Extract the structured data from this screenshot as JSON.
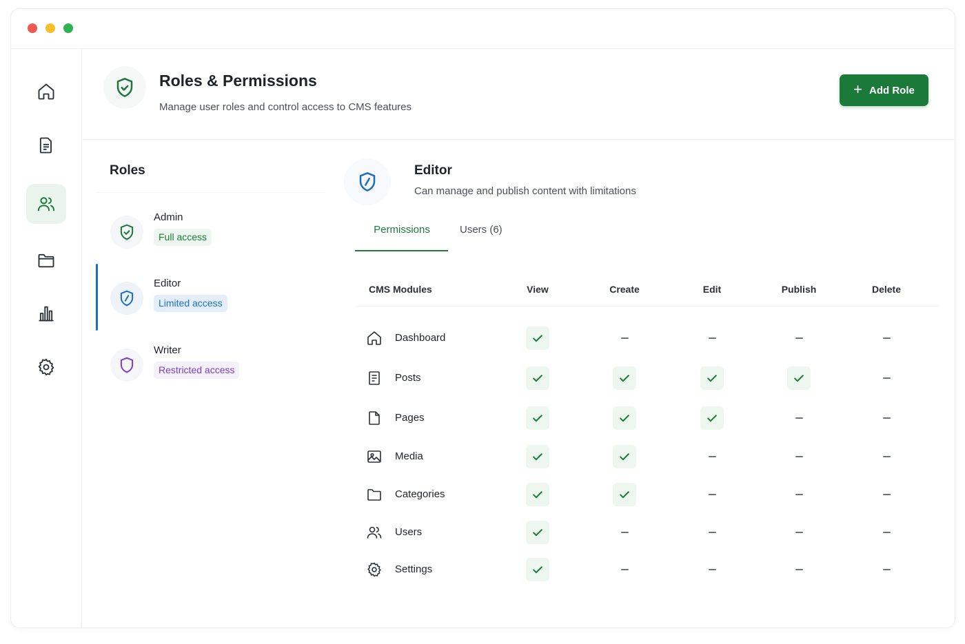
{
  "header": {
    "title": "Roles & Permissions",
    "subtitle": "Manage user roles and control access to CMS features",
    "add_role_label": "Add Role"
  },
  "nav": [
    {
      "name": "home-icon",
      "active": false
    },
    {
      "name": "document-icon",
      "active": false
    },
    {
      "name": "users-icon",
      "active": true
    },
    {
      "name": "folder-icon",
      "active": false
    },
    {
      "name": "bar-chart-icon",
      "active": false
    },
    {
      "name": "gear-icon",
      "active": false
    }
  ],
  "roles": {
    "heading": "Roles",
    "items": [
      {
        "name": "Admin",
        "badge": "Full access",
        "color": "#1b7a3a"
      },
      {
        "name": "Editor",
        "badge": "Limited access",
        "color": "#1a6fc4",
        "selected": true
      },
      {
        "name": "Writer",
        "badge": "Restricted access",
        "color": "#7a3fc6"
      }
    ]
  },
  "detail": {
    "title": "Editor",
    "subtitle": "Can manage and publish content with limitations",
    "tabs": [
      {
        "label": "Permissions",
        "active": true
      },
      {
        "label": "Users (6)",
        "active": false
      }
    ]
  },
  "permissions": {
    "columns": [
      "CMS Modules",
      "View",
      "Create",
      "Edit",
      "Publish",
      "Delete"
    ],
    "rows": [
      {
        "module": "Dashboard",
        "icon": "home-icon",
        "values": [
          true,
          false,
          false,
          false,
          false
        ]
      },
      {
        "module": "Posts",
        "icon": "document-icon",
        "values": [
          true,
          true,
          true,
          true,
          false
        ]
      },
      {
        "module": "Pages",
        "icon": "page-icon",
        "values": [
          true,
          true,
          true,
          false,
          false
        ]
      },
      {
        "module": "Media",
        "icon": "image-icon",
        "values": [
          true,
          true,
          false,
          false,
          false
        ]
      },
      {
        "module": "Categories",
        "icon": "folder-icon",
        "values": [
          true,
          true,
          false,
          false,
          false
        ]
      },
      {
        "module": "Users",
        "icon": "users-icon",
        "values": [
          true,
          false,
          false,
          false,
          false
        ]
      },
      {
        "module": "Settings",
        "icon": "gear-icon",
        "values": [
          true,
          false,
          false,
          false,
          false
        ]
      }
    ]
  },
  "colors": {
    "accent": "#1b7a3a",
    "editor_blue": "#1a6fc4",
    "writer_purple": "#7a3fc6",
    "check_bg": "#eef6f0"
  }
}
